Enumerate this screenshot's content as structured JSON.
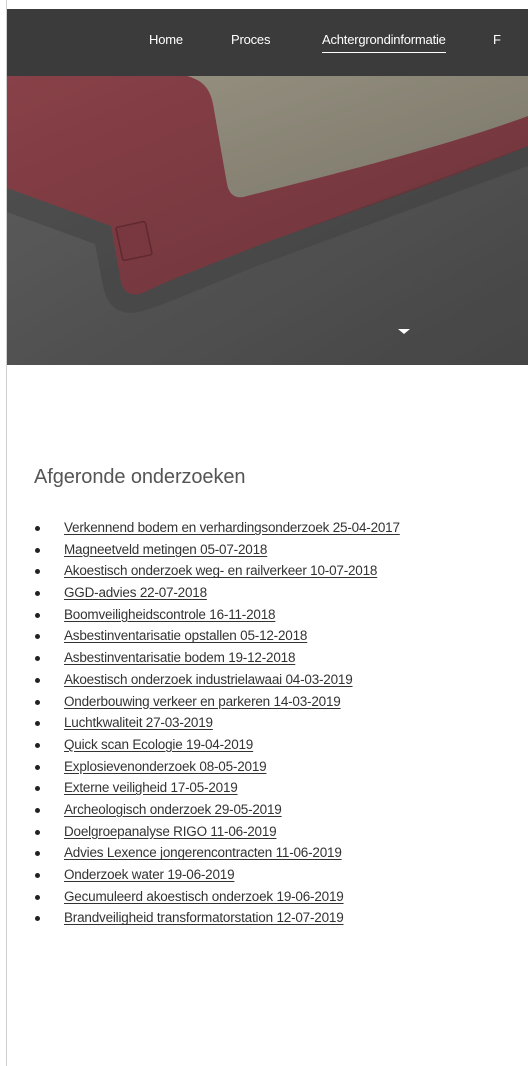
{
  "nav": {
    "items": [
      {
        "label": "Home",
        "active": false
      },
      {
        "label": "Proces",
        "active": false
      },
      {
        "label": "Achtergrondinformatie",
        "active": true
      },
      {
        "label": "F",
        "active": false
      }
    ]
  },
  "hero": {
    "scroll_icon": "chevron-down-icon"
  },
  "section": {
    "title": "Afgeronde onderzoeken",
    "items": [
      "Verkennend bodem en verhardingsonderzoek 25-04-2017",
      "Magneetveld metingen 05-07-2018",
      "Akoestisch onderzoek weg- en railverkeer 10-07-2018",
      "GGD-advies 22-07-2018",
      "Boomveiligheidscontrole 16-11-2018",
      "Asbestinventarisatie opstallen 05-12-2018",
      "Asbestinventarisatie bodem 19-12-2018",
      "Akoestisch onderzoek industrielawaai 04-03-2019",
      "Onderbouwing verkeer en parkeren 14-03-2019",
      "Luchtkwaliteit 27-03-2019",
      "Quick scan Ecologie 19-04-2019",
      "Explosievenonderzoek 08-05-2019",
      "Externe veiligheid 17-05-2019",
      "Archeologisch onderzoek 29-05-2019",
      "Doelgroepanalyse RIGO 11-06-2019",
      "Advies Lexence jongerencontracten 11-06-2019",
      "Onderzoek water 19-06-2019",
      "Gecumuleerd akoestisch onderzoek 19-06-2019",
      "Brandveiligheid transformatorstation 12-07-2019"
    ]
  },
  "colors": {
    "nav_background": "#3b3b3b",
    "text_dark": "#333333",
    "heading": "#555555"
  }
}
